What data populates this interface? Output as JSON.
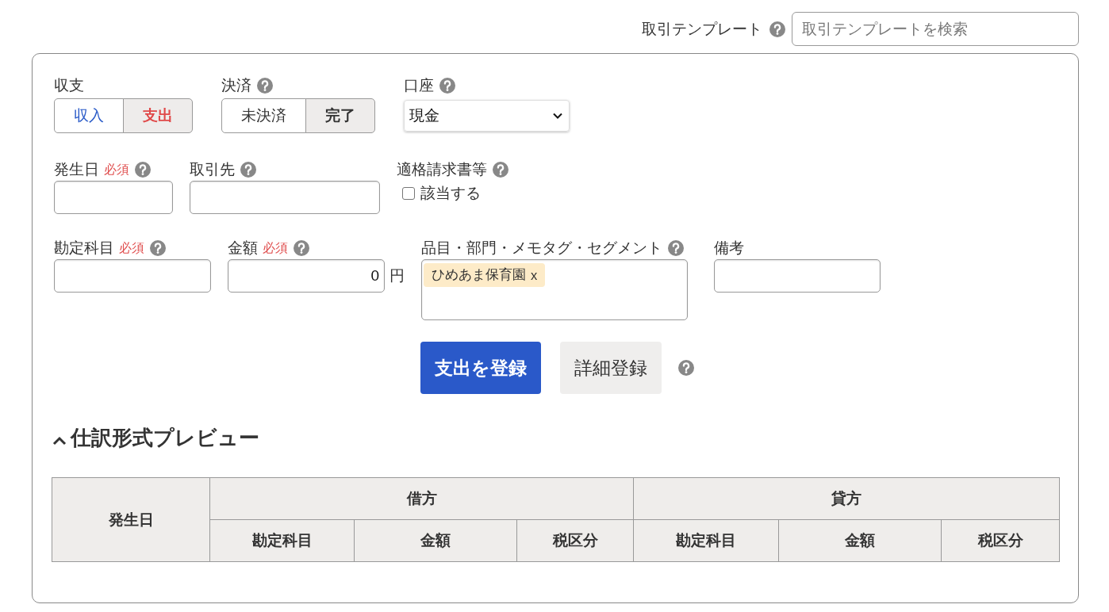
{
  "template_search": {
    "label": "取引テンプレート",
    "help": true,
    "placeholder": "取引テンプレートを検索"
  },
  "form_rows": [
    {
      "fields": [
        {
          "kind": "segmented",
          "label": "収支",
          "help": false,
          "options": [
            {
              "label": "収入",
              "selected": false,
              "color": "#2a5bc8"
            },
            {
              "label": "支出",
              "selected": true,
              "color": "#e04848"
            }
          ]
        },
        {
          "kind": "segmented",
          "label": "決済",
          "help": true,
          "options": [
            {
              "label": "未決済",
              "selected": false
            },
            {
              "label": "完了",
              "selected": true
            }
          ]
        },
        {
          "kind": "select",
          "label": "口座",
          "help": true,
          "value": "現金"
        }
      ]
    },
    {
      "fields": [
        {
          "kind": "text",
          "label": "発生日",
          "required_mark": "必須",
          "help": true
        },
        {
          "kind": "text",
          "label": "取引先",
          "help": true
        },
        {
          "kind": "checkbox",
          "label": "適格請求書等",
          "help": true,
          "option": "該当する",
          "checked": false
        }
      ]
    },
    {
      "fields": [
        {
          "kind": "text",
          "label": "勘定科目",
          "required_mark": "必須",
          "help": true
        },
        {
          "kind": "amount",
          "label": "金額",
          "required_mark": "必須",
          "help": true,
          "value": "0",
          "unit": "円"
        },
        {
          "kind": "tags",
          "label": "品目・部門・メモタグ・セグメント",
          "help": true,
          "tags": [
            {
              "label": "ひめあま保育園",
              "remove": "x"
            }
          ]
        },
        {
          "kind": "text",
          "label": "備考",
          "help": false
        }
      ]
    }
  ],
  "actions": {
    "primary": "支出を登録",
    "secondary": "詳細登録",
    "help": true
  },
  "preview": {
    "title": "仕訳形式プレビュー",
    "expanded": true,
    "table": {
      "columns": [
        {
          "label": "発生日"
        },
        {
          "label": "借方",
          "children": [
            {
              "label": "勘定科目"
            },
            {
              "label": "金額"
            },
            {
              "label": "税区分"
            }
          ]
        },
        {
          "label": "貸方",
          "children": [
            {
              "label": "勘定科目"
            },
            {
              "label": "金額"
            },
            {
              "label": "税区分"
            }
          ]
        }
      ]
    }
  }
}
